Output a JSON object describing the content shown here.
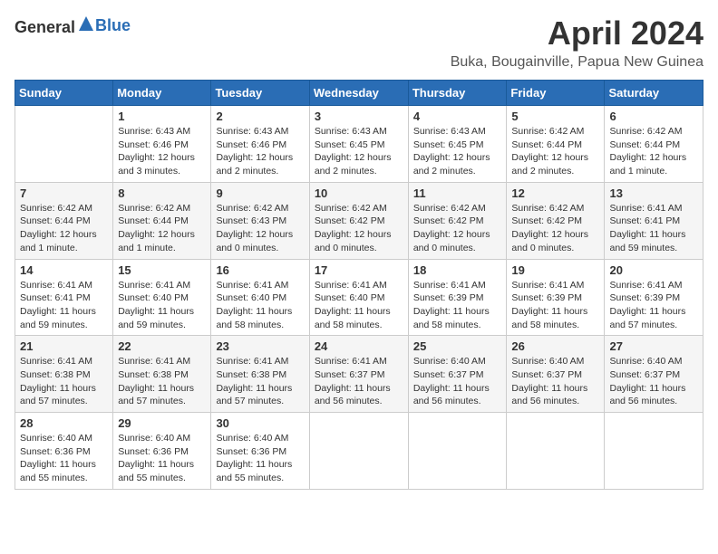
{
  "logo": {
    "general": "General",
    "blue": "Blue"
  },
  "title": "April 2024",
  "location": "Buka, Bougainville, Papua New Guinea",
  "weekdays": [
    "Sunday",
    "Monday",
    "Tuesday",
    "Wednesday",
    "Thursday",
    "Friday",
    "Saturday"
  ],
  "weeks": [
    [
      {
        "day": "",
        "sunrise": "",
        "sunset": "",
        "daylight": ""
      },
      {
        "day": "1",
        "sunrise": "Sunrise: 6:43 AM",
        "sunset": "Sunset: 6:46 PM",
        "daylight": "Daylight: 12 hours and 3 minutes."
      },
      {
        "day": "2",
        "sunrise": "Sunrise: 6:43 AM",
        "sunset": "Sunset: 6:46 PM",
        "daylight": "Daylight: 12 hours and 2 minutes."
      },
      {
        "day": "3",
        "sunrise": "Sunrise: 6:43 AM",
        "sunset": "Sunset: 6:45 PM",
        "daylight": "Daylight: 12 hours and 2 minutes."
      },
      {
        "day": "4",
        "sunrise": "Sunrise: 6:43 AM",
        "sunset": "Sunset: 6:45 PM",
        "daylight": "Daylight: 12 hours and 2 minutes."
      },
      {
        "day": "5",
        "sunrise": "Sunrise: 6:42 AM",
        "sunset": "Sunset: 6:44 PM",
        "daylight": "Daylight: 12 hours and 2 minutes."
      },
      {
        "day": "6",
        "sunrise": "Sunrise: 6:42 AM",
        "sunset": "Sunset: 6:44 PM",
        "daylight": "Daylight: 12 hours and 1 minute."
      }
    ],
    [
      {
        "day": "7",
        "sunrise": "Sunrise: 6:42 AM",
        "sunset": "Sunset: 6:44 PM",
        "daylight": "Daylight: 12 hours and 1 minute."
      },
      {
        "day": "8",
        "sunrise": "Sunrise: 6:42 AM",
        "sunset": "Sunset: 6:44 PM",
        "daylight": "Daylight: 12 hours and 1 minute."
      },
      {
        "day": "9",
        "sunrise": "Sunrise: 6:42 AM",
        "sunset": "Sunset: 6:43 PM",
        "daylight": "Daylight: 12 hours and 0 minutes."
      },
      {
        "day": "10",
        "sunrise": "Sunrise: 6:42 AM",
        "sunset": "Sunset: 6:42 PM",
        "daylight": "Daylight: 12 hours and 0 minutes."
      },
      {
        "day": "11",
        "sunrise": "Sunrise: 6:42 AM",
        "sunset": "Sunset: 6:42 PM",
        "daylight": "Daylight: 12 hours and 0 minutes."
      },
      {
        "day": "12",
        "sunrise": "Sunrise: 6:42 AM",
        "sunset": "Sunset: 6:42 PM",
        "daylight": "Daylight: 12 hours and 0 minutes."
      },
      {
        "day": "13",
        "sunrise": "Sunrise: 6:41 AM",
        "sunset": "Sunset: 6:41 PM",
        "daylight": "Daylight: 11 hours and 59 minutes."
      }
    ],
    [
      {
        "day": "14",
        "sunrise": "Sunrise: 6:41 AM",
        "sunset": "Sunset: 6:41 PM",
        "daylight": "Daylight: 11 hours and 59 minutes."
      },
      {
        "day": "15",
        "sunrise": "Sunrise: 6:41 AM",
        "sunset": "Sunset: 6:40 PM",
        "daylight": "Daylight: 11 hours and 59 minutes."
      },
      {
        "day": "16",
        "sunrise": "Sunrise: 6:41 AM",
        "sunset": "Sunset: 6:40 PM",
        "daylight": "Daylight: 11 hours and 58 minutes."
      },
      {
        "day": "17",
        "sunrise": "Sunrise: 6:41 AM",
        "sunset": "Sunset: 6:40 PM",
        "daylight": "Daylight: 11 hours and 58 minutes."
      },
      {
        "day": "18",
        "sunrise": "Sunrise: 6:41 AM",
        "sunset": "Sunset: 6:39 PM",
        "daylight": "Daylight: 11 hours and 58 minutes."
      },
      {
        "day": "19",
        "sunrise": "Sunrise: 6:41 AM",
        "sunset": "Sunset: 6:39 PM",
        "daylight": "Daylight: 11 hours and 58 minutes."
      },
      {
        "day": "20",
        "sunrise": "Sunrise: 6:41 AM",
        "sunset": "Sunset: 6:39 PM",
        "daylight": "Daylight: 11 hours and 57 minutes."
      }
    ],
    [
      {
        "day": "21",
        "sunrise": "Sunrise: 6:41 AM",
        "sunset": "Sunset: 6:38 PM",
        "daylight": "Daylight: 11 hours and 57 minutes."
      },
      {
        "day": "22",
        "sunrise": "Sunrise: 6:41 AM",
        "sunset": "Sunset: 6:38 PM",
        "daylight": "Daylight: 11 hours and 57 minutes."
      },
      {
        "day": "23",
        "sunrise": "Sunrise: 6:41 AM",
        "sunset": "Sunset: 6:38 PM",
        "daylight": "Daylight: 11 hours and 57 minutes."
      },
      {
        "day": "24",
        "sunrise": "Sunrise: 6:41 AM",
        "sunset": "Sunset: 6:37 PM",
        "daylight": "Daylight: 11 hours and 56 minutes."
      },
      {
        "day": "25",
        "sunrise": "Sunrise: 6:40 AM",
        "sunset": "Sunset: 6:37 PM",
        "daylight": "Daylight: 11 hours and 56 minutes."
      },
      {
        "day": "26",
        "sunrise": "Sunrise: 6:40 AM",
        "sunset": "Sunset: 6:37 PM",
        "daylight": "Daylight: 11 hours and 56 minutes."
      },
      {
        "day": "27",
        "sunrise": "Sunrise: 6:40 AM",
        "sunset": "Sunset: 6:37 PM",
        "daylight": "Daylight: 11 hours and 56 minutes."
      }
    ],
    [
      {
        "day": "28",
        "sunrise": "Sunrise: 6:40 AM",
        "sunset": "Sunset: 6:36 PM",
        "daylight": "Daylight: 11 hours and 55 minutes."
      },
      {
        "day": "29",
        "sunrise": "Sunrise: 6:40 AM",
        "sunset": "Sunset: 6:36 PM",
        "daylight": "Daylight: 11 hours and 55 minutes."
      },
      {
        "day": "30",
        "sunrise": "Sunrise: 6:40 AM",
        "sunset": "Sunset: 6:36 PM",
        "daylight": "Daylight: 11 hours and 55 minutes."
      },
      {
        "day": "",
        "sunrise": "",
        "sunset": "",
        "daylight": ""
      },
      {
        "day": "",
        "sunrise": "",
        "sunset": "",
        "daylight": ""
      },
      {
        "day": "",
        "sunrise": "",
        "sunset": "",
        "daylight": ""
      },
      {
        "day": "",
        "sunrise": "",
        "sunset": "",
        "daylight": ""
      }
    ]
  ]
}
